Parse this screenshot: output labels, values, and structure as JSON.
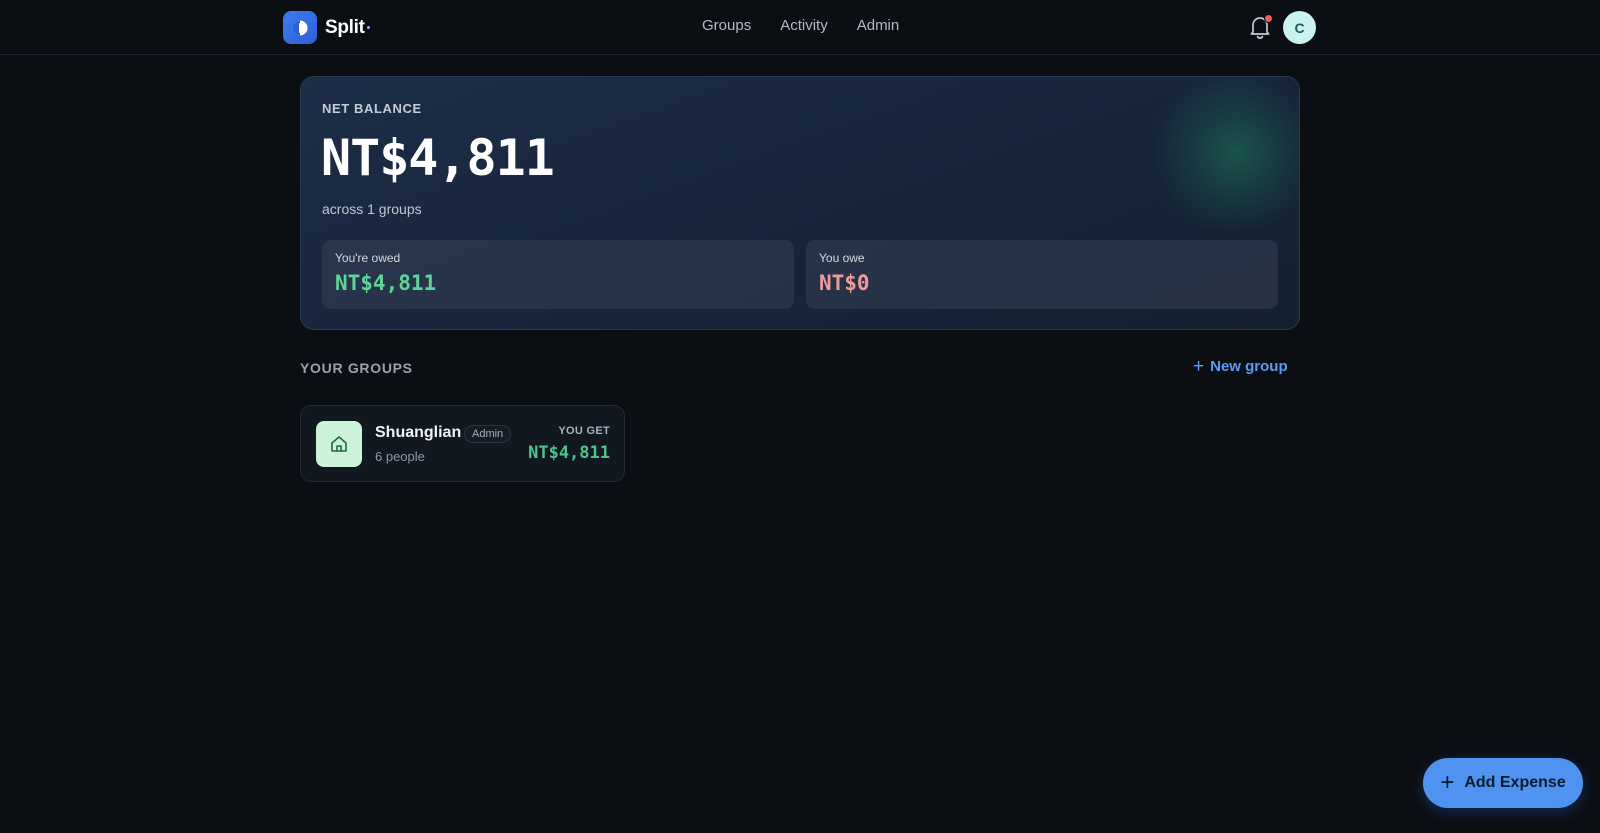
{
  "app": {
    "name": "Split"
  },
  "nav": {
    "items": [
      "Groups",
      "Activity",
      "Admin"
    ]
  },
  "user": {
    "avatar_initial": "C",
    "has_notifications": true
  },
  "balance": {
    "label": "NET BALANCE",
    "amount": "NT$4,811",
    "subtitle": "across 1 groups",
    "owed": {
      "label": "You're owed",
      "amount": "NT$4,811"
    },
    "owe": {
      "label": "You owe",
      "amount": "NT$0"
    }
  },
  "groups_section": {
    "title": "YOUR GROUPS",
    "new_group_label": "New group",
    "groups": [
      {
        "name": "Shuanglian",
        "badge": "Admin",
        "people": "6 people",
        "status_label": "YOU GET",
        "amount": "NT$4,811",
        "icon": "home-icon"
      }
    ]
  },
  "fab": {
    "label": "Add Expense"
  },
  "colors": {
    "background": "#0b0e13",
    "accent": "#4f93f0",
    "positive": "#5fd59a",
    "negative": "#f29a9a",
    "notification": "#ef5b5b"
  }
}
